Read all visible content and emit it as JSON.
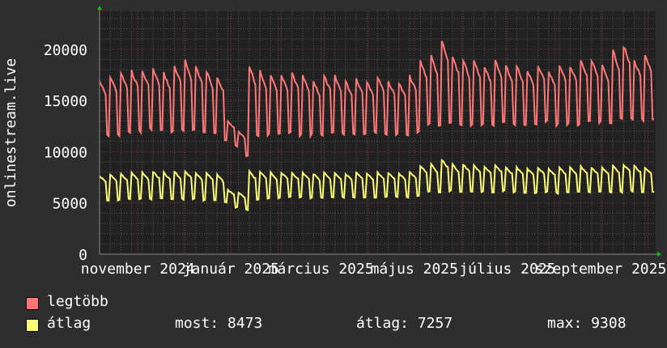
{
  "chart_data": {
    "type": "line",
    "ylabel": "onlinestream.live",
    "ylim": [
      0,
      23700
    ],
    "yticks": [
      0,
      5000,
      10000,
      15000,
      20000
    ],
    "ytick_labels": [
      "0",
      "5000",
      "10000",
      "15000",
      "20000"
    ],
    "xtick_labels": [
      "november 2024",
      "január 2025",
      "március 2025",
      "május 2025",
      "július 2025",
      "szeptember 2025"
    ],
    "x_unit": "week (weekday high / weekend low pattern)",
    "grid": true,
    "series": [
      {
        "name": "legtöbb",
        "color": "#ff7777",
        "weekly_high": [
          17000,
          17500,
          17800,
          18000,
          18000,
          18200,
          17800,
          18500,
          19000,
          18500,
          18000,
          17500,
          13000,
          12000,
          18500,
          18000,
          17500,
          17500,
          17800,
          17500,
          17000,
          17500,
          17500,
          17000,
          17300,
          17000,
          17500,
          17000,
          16800,
          17500,
          19000,
          19500,
          21000,
          19500,
          19000,
          19000,
          18500,
          19000,
          18500,
          18500,
          18000,
          18500,
          18000,
          18500,
          18500,
          19000,
          19000,
          18500,
          20000,
          20500,
          19000,
          19500
        ],
        "weekly_low": [
          11500,
          11500,
          11800,
          11800,
          12000,
          12000,
          11800,
          12000,
          12000,
          11800,
          11500,
          11000,
          10500,
          9500,
          11500,
          11500,
          11500,
          11800,
          11500,
          11500,
          11500,
          11800,
          11500,
          11500,
          11500,
          11800,
          11500,
          11500,
          11500,
          11800,
          12500,
          12500,
          12800,
          12500,
          12500,
          12500,
          12500,
          12800,
          12500,
          12500,
          12500,
          12800,
          12500,
          12500,
          12500,
          12800,
          12800,
          12500,
          13000,
          13000,
          13000,
          13000
        ]
      },
      {
        "name": "átlag",
        "color": "#ffff77",
        "weekly_high": [
          7700,
          7800,
          7900,
          8000,
          8000,
          8100,
          8000,
          8100,
          8200,
          8000,
          8000,
          7800,
          6300,
          6000,
          8100,
          8100,
          8000,
          8000,
          8000,
          8000,
          7900,
          8000,
          8000,
          7900,
          8000,
          7900,
          8000,
          8000,
          7900,
          8100,
          8700,
          8800,
          9300,
          8800,
          8800,
          8700,
          8600,
          8700,
          8500,
          8500,
          8400,
          8500,
          8400,
          8500,
          8500,
          8600,
          8500,
          8500,
          8700,
          8800,
          8700,
          8500
        ],
        "weekly_low": [
          5200,
          5200,
          5300,
          5300,
          5300,
          5400,
          5300,
          5300,
          5300,
          5200,
          5200,
          5000,
          4500,
          4300,
          5300,
          5400,
          5400,
          5500,
          5500,
          5400,
          5400,
          5500,
          5500,
          5500,
          5500,
          5500,
          5500,
          5500,
          5500,
          5600,
          6000,
          6000,
          6100,
          6000,
          6000,
          6000,
          6000,
          6100,
          6000,
          5900,
          5900,
          6000,
          5900,
          6000,
          6000,
          6000,
          6000,
          6000,
          6000,
          6100,
          6000,
          6000
        ]
      }
    ]
  },
  "legend": {
    "items": [
      {
        "label": "legtöbb",
        "color": "#ff7777"
      },
      {
        "label": "átlag",
        "color": "#ffff77"
      }
    ],
    "stats": {
      "now": "most: 8473",
      "avg": "átlag: 7257",
      "max": "max: 9308"
    }
  }
}
